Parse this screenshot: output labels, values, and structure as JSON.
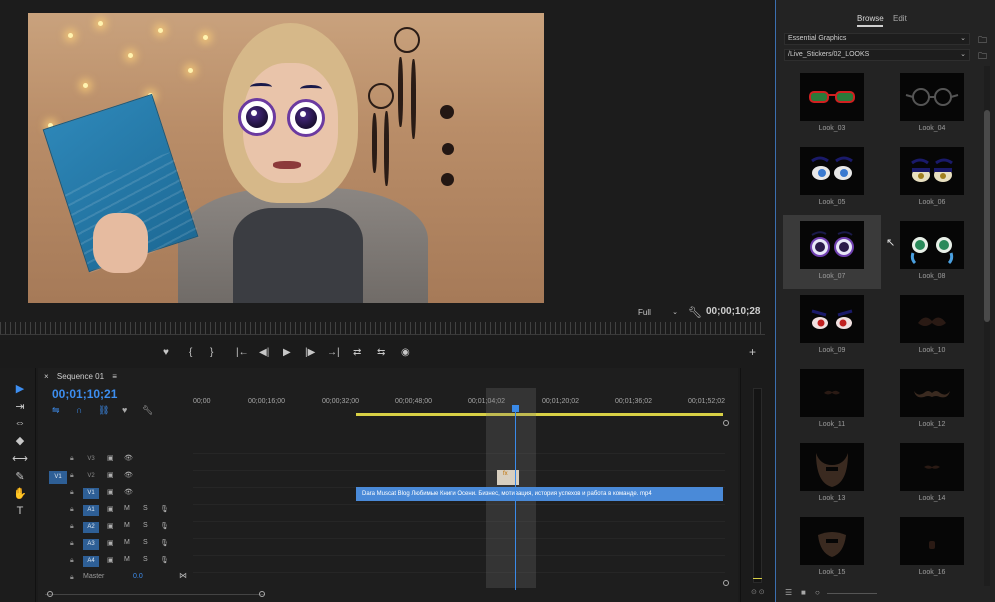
{
  "program_monitor": {
    "zoom": "Full",
    "timecode": "00;00;10;28",
    "transport": [
      "♥",
      "{",
      "}",
      "|←",
      "◀|",
      "▶",
      "|▶",
      "→|",
      "⇄",
      "⇆",
      "◉"
    ],
    "add": "+"
  },
  "timeline": {
    "sequence_name": "Sequence 01",
    "menu_icon": "≡",
    "timecode": "00;01;10;21",
    "ruler": [
      "00;00",
      "00;00;16;00",
      "00;00;32;00",
      "00;00;48;00",
      "00;01;04;02",
      "00;01;20;02",
      "00;01;36;02",
      "00;01;52;02"
    ],
    "tracks": [
      {
        "name": "V3",
        "type": "video",
        "target": "",
        "active": false
      },
      {
        "name": "V2",
        "type": "video",
        "target": "",
        "active": false
      },
      {
        "name": "V1",
        "type": "video",
        "target": "V1",
        "active": true
      },
      {
        "name": "A1",
        "type": "audio",
        "target": "",
        "active": true,
        "m": "M",
        "s": "S"
      },
      {
        "name": "A2",
        "type": "audio",
        "target": "",
        "active": true,
        "m": "M",
        "s": "S"
      },
      {
        "name": "A3",
        "type": "audio",
        "target": "",
        "active": true,
        "m": "M",
        "s": "S"
      },
      {
        "name": "A4",
        "type": "audio",
        "target": "",
        "active": true,
        "m": "M",
        "s": "S"
      }
    ],
    "master": {
      "label": "Master",
      "value": "0.0"
    },
    "clip_label": "Dara Muscat Blog  Любимые Книги Осени. Бизнес, мотивация, история успехов и работа в команде. mp4",
    "sticker_clip_icon": "fx"
  },
  "tools": [
    "▶",
    "⇥",
    "⇔",
    "◆",
    "⟷",
    "✎",
    "✋",
    "T"
  ],
  "essential_graphics": {
    "tabs": [
      "Browse",
      "Edit"
    ],
    "active_tab": "Browse",
    "source_dropdown": "Essential Graphics",
    "path_dropdown": "/Live_Stickers/02_LOOKS",
    "items": [
      "Look_03",
      "Look_04",
      "Look_05",
      "Look_06",
      "Look_07",
      "Look_08",
      "Look_09",
      "Look_10",
      "Look_11",
      "Look_12",
      "Look_13",
      "Look_14",
      "Look_15",
      "Look_16"
    ],
    "selected": "Look_07"
  },
  "colors": {
    "accent": "#3d8ef0",
    "clip": "#4a8ad8",
    "panel_bg": "#232323"
  }
}
